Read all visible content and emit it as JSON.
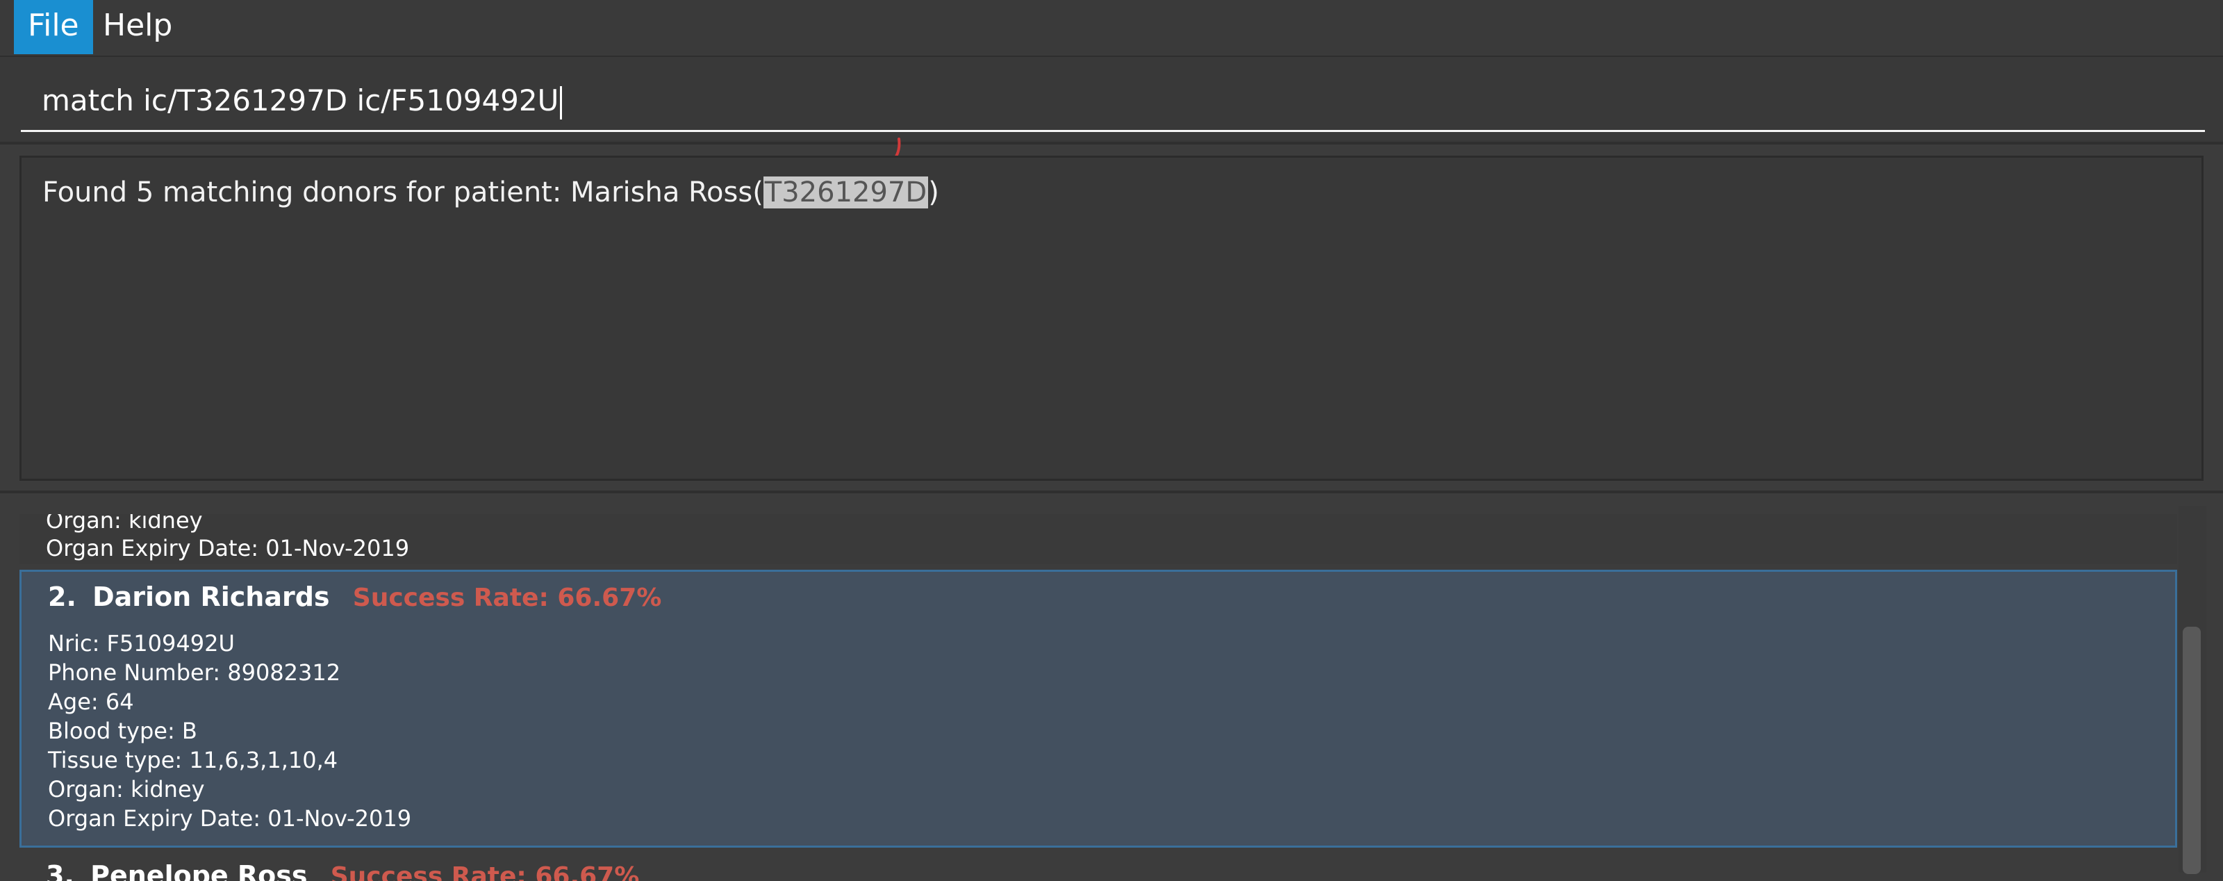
{
  "menu": {
    "file": "File",
    "help": "Help"
  },
  "command": {
    "value": "match ic/T3261297D ic/F5109492U"
  },
  "result": {
    "prefix": "Found 5 matching donors for patient: Marisha Ross(",
    "highlight": "T3261297D",
    "suffix": ")"
  },
  "list": {
    "partial_card": {
      "organ": "Organ: kidney",
      "expiry": "Organ Expiry Date: 01-Nov-2019"
    },
    "selected_card": {
      "index": "2.",
      "name": "Darion Richards",
      "success_rate": "Success Rate: 66.67%",
      "nric": "Nric: F5109492U",
      "phone": "Phone Number: 89082312",
      "age": "Age: 64",
      "blood": "Blood type: B",
      "tissue": "Tissue type: 11,6,3,1,10,4",
      "organ": "Organ: kidney",
      "expiry": "Organ Expiry Date: 01-Nov-2019"
    },
    "next_card": {
      "index": "3.",
      "name": "Penelope Ross",
      "success_rate": "Success Rate: 66.67%"
    }
  },
  "colors": {
    "accent": "#1a8fd1",
    "success_rate": "#cf5a4e",
    "selected_bg": "#43505f"
  }
}
